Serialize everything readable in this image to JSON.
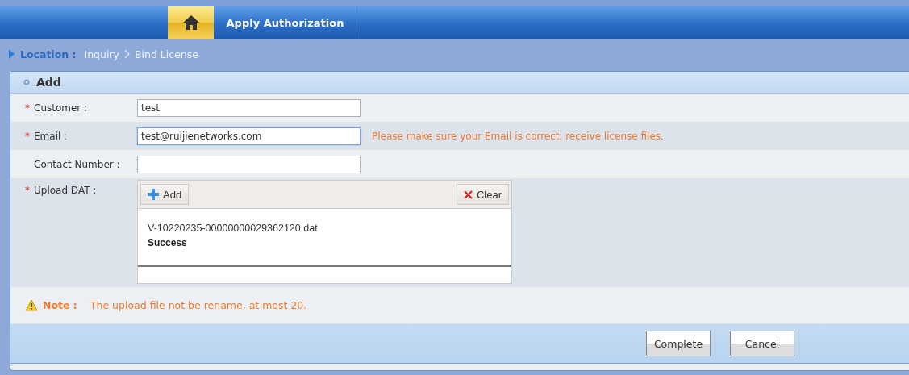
{
  "nav": {
    "tabs": [
      {
        "kind": "home",
        "selected": true
      },
      {
        "kind": "text",
        "label": "Apply Authorization",
        "selected": false
      }
    ]
  },
  "breadcrumb": {
    "label": "Location :",
    "items": [
      "Inquiry",
      "Bind License"
    ]
  },
  "panel": {
    "title": "Add",
    "rows": [
      {
        "kind": "input",
        "label": "Customer :",
        "required_mark": "*",
        "value": "test",
        "focused": false
      },
      {
        "kind": "input",
        "label": "Email :",
        "required_mark": "*",
        "value": "test@ruijienetworks.com",
        "focused": true,
        "hint": "Please make sure your Email is correct, receive license files."
      },
      {
        "kind": "input",
        "label": "Contact Number :",
        "value": "",
        "focused": false
      },
      {
        "kind": "upload",
        "label": "Upload DAT :",
        "required_mark": "*",
        "add_button": "Add",
        "clear_button": "Clear",
        "files": [
          {
            "name": "V-10220235-00000000029362120.dat",
            "status": "Success"
          }
        ]
      }
    ],
    "note": {
      "label": "Note :",
      "text": "The upload file not be rename, at most 20."
    },
    "buttons": [
      "Complete",
      "Cancel"
    ]
  }
}
